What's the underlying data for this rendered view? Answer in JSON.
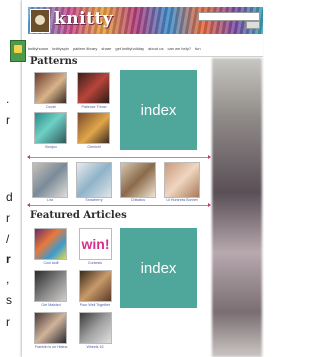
{
  "left_fragments": [
    {
      "text": "."
    },
    {
      "text": "r"
    },
    {
      "text": "d"
    },
    {
      "text": "r"
    },
    {
      "text": "/"
    },
    {
      "text": "r"
    },
    {
      "text": ","
    },
    {
      "text": "s"
    },
    {
      "text": "r"
    }
  ],
  "header": {
    "logo_text": "knitty"
  },
  "nav": {
    "items": [
      "knittyhouse",
      "knittyspin",
      "pattern library",
      "share",
      "get knittyholiday",
      "about us",
      "can we help?",
      "fun"
    ]
  },
  "patterns": {
    "heading": "Patterns",
    "row1": [
      "Duvet",
      "Patience Throw",
      "Bonjou",
      "Gemichi"
    ],
    "row2": [
      "Lira",
      "Snowberry",
      "Chibatus",
      "Lil Huntress Bonnet"
    ]
  },
  "index_label": "index",
  "featured": {
    "heading": "Featured Articles",
    "items": [
      "Cool stuff",
      "Contests",
      "Get Maisied",
      "Pour Well Together",
      "Franklin is on Hiatus",
      "Wheels 16"
    ],
    "contest_label": "win!"
  },
  "colors": {
    "index_bg": "#4ea79a",
    "accent_pink": "#d6318f",
    "caption_blue": "#4a5aa8"
  }
}
